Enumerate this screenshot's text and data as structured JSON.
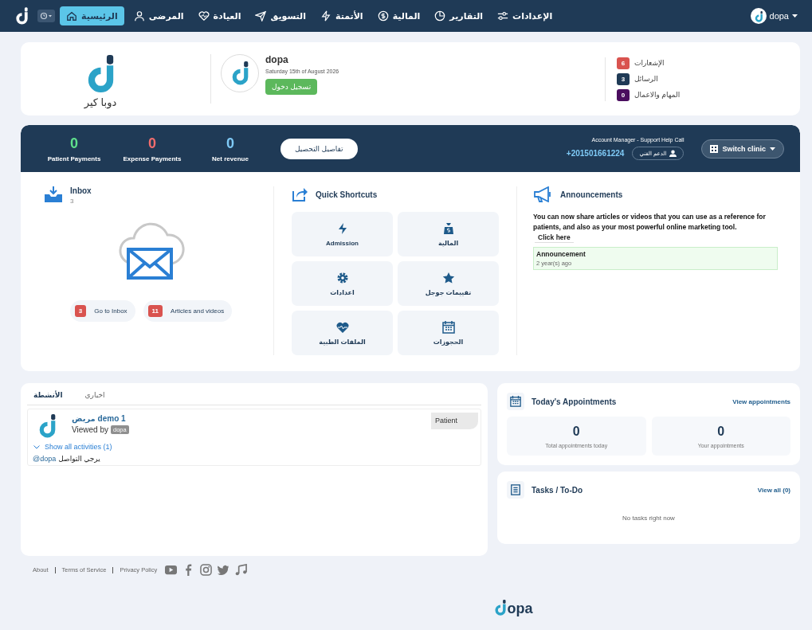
{
  "nav": {
    "items": [
      {
        "label": "الإعدادات",
        "selected": false
      },
      {
        "label": "التقارير",
        "selected": false
      },
      {
        "label": "المالية",
        "selected": false
      },
      {
        "label": "الأتمتة",
        "selected": false
      },
      {
        "label": "التسويق",
        "selected": false
      },
      {
        "label": "العيادة",
        "selected": false
      },
      {
        "label": "المرضى",
        "selected": false
      },
      {
        "label": "الرئيسية",
        "selected": true
      }
    ],
    "user": "dopa"
  },
  "profile": {
    "clinic_name": "دوبا كير",
    "user_name": "dopa",
    "date": "Saturday 15th of August 2026",
    "login_button": "تسجيل دخول",
    "counters": [
      {
        "label": "الإشعارات",
        "count": "6",
        "color": "#d9534f"
      },
      {
        "label": "الرسائل",
        "count": "3",
        "color": "#1f3a56"
      },
      {
        "label": "المهام والاعمال",
        "count": "0",
        "color": "#4a0d5e"
      }
    ]
  },
  "summary": {
    "stats": [
      {
        "value": "0",
        "label": "Net revenue",
        "color": "#7fcaf6"
      },
      {
        "value": "0",
        "label": "Expense Payments",
        "color": "#f26d6d"
      },
      {
        "value": "0",
        "label": "Patient Payments",
        "color": "#5fe08c"
      }
    ],
    "details_button": "تفاصيل التحصيل",
    "support_title": "Account Manager - Support Help Call",
    "phone": "+201501661224",
    "support_button": "الدعم الفني",
    "switch_button": "Switch clinic"
  },
  "inbox": {
    "title": "Inbox",
    "count": "3",
    "buttons": [
      {
        "count": "11",
        "label": "Articles and videos"
      },
      {
        "count": "3",
        "label": "Go to Inbox"
      }
    ]
  },
  "shortcuts": {
    "title": "Quick Shortcuts",
    "items": [
      "المالية",
      "Admission",
      "تقييمات جوجل",
      "اعدادات",
      "الحجوزات",
      "الملفات الطبية"
    ]
  },
  "announcements": {
    "title": "Announcements",
    "text": "You can now share articles or videos that you can use as a reference for patients, and also as your most powerful online marketing tool.",
    "link": "Click here",
    "item": {
      "title": "Announcement",
      "time": "2 year(s) ago"
    }
  },
  "activity": {
    "tabs": [
      {
        "label": "اخباري",
        "selected": false
      },
      {
        "label": "الأنشطة",
        "selected": true
      }
    ],
    "entries": [
      {
        "title": "مريض demo 1",
        "viewed_by": "Viewed by",
        "viewer": "dopa",
        "tag": "Patient",
        "toggle": "Show all activities (1)",
        "mention": "@dopa",
        "message": "يرجي التواصل"
      }
    ]
  },
  "appointments": {
    "title": "Today's Appointments",
    "link": "View appointments",
    "stats": [
      {
        "value": "0",
        "label": "Your appointments"
      },
      {
        "value": "0",
        "label": "Total appointments today"
      }
    ]
  },
  "tasks": {
    "title": "Tasks / To-Do",
    "link": "View all (0)",
    "empty": "No tasks right now"
  },
  "footer": {
    "links": [
      "Privacy Policy",
      "Terms of Service",
      "About"
    ],
    "logo_text": "opa"
  }
}
